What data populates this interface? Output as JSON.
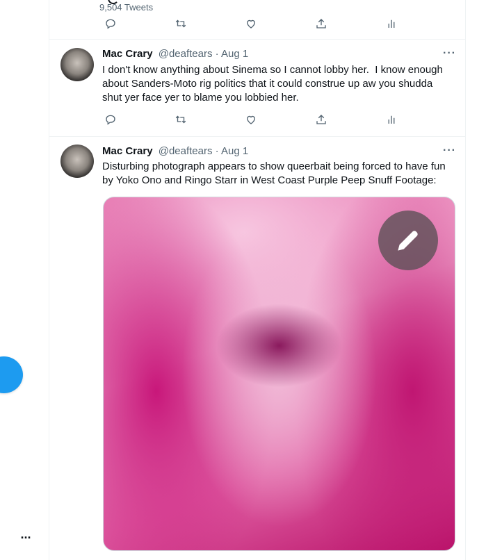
{
  "profile_header": {
    "tweet_count": "9,504 Tweets"
  },
  "icons": {
    "reply": "reply-icon",
    "retweet": "retweet-icon",
    "like": "heart-icon",
    "share": "share-icon",
    "analytics": "analytics-icon",
    "more": "more-dots-icon",
    "edit": "pencil-icon"
  },
  "colors": {
    "accent": "#1d9bf0",
    "text_secondary": "#536471"
  },
  "tweets": [
    {
      "name": "Mac Crary",
      "handle": "@deaftears",
      "separator": " · ",
      "date": "Aug 1",
      "more": "···",
      "text": "I don't know anything about Sinema so I cannot lobby her.  I know enough\nabout Sanders-Moto rig politics that it could construe up aw you shudda\nshut yer face yer to blame you lobbied her."
    },
    {
      "name": "Mac Crary",
      "handle": "@deaftears",
      "separator": " · ",
      "date": "Aug 1",
      "more": "···",
      "text": "Disturbing photograph appears to show queerbait being forced to have fun\nby Yoko Ono and Ringo Starr in West Coast Purple Peep Snuff Footage:"
    }
  ],
  "left_nav": {
    "more_label": "···"
  }
}
